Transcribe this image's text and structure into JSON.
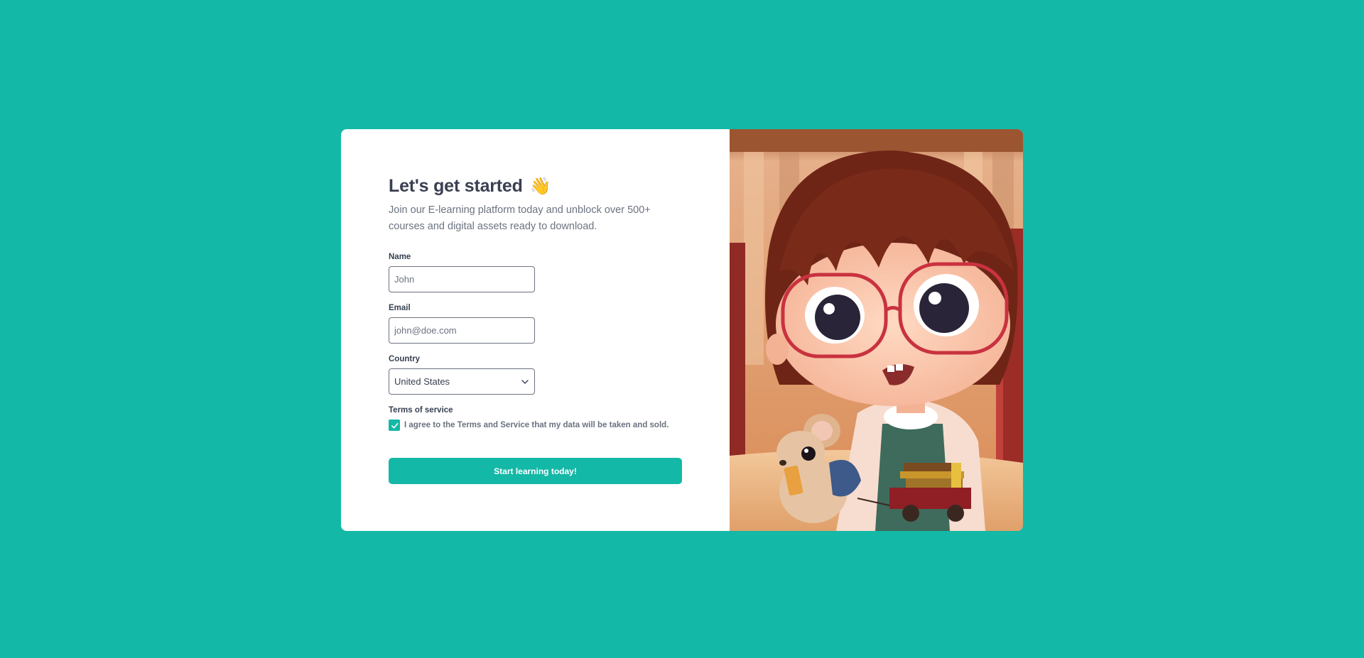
{
  "colors": {
    "background": "#14b8a6",
    "accent": "#14b8a6",
    "card": "#ffffff"
  },
  "form": {
    "title": "Let's get started",
    "title_emoji": "👋",
    "subtitle": "Join our E-learning platform today and unblock over 500+ courses and digital assets ready to download.",
    "name": {
      "label": "Name",
      "placeholder": "John"
    },
    "email": {
      "label": "Email",
      "placeholder": "john@doe.com"
    },
    "country": {
      "label": "Country",
      "selected": "United States",
      "icon": "chevron-down-icon"
    },
    "terms": {
      "label": "Terms of service",
      "checked": true,
      "text": "I agree to the Terms and Service that my data will be taken and sold."
    },
    "submit_label": "Start learning today!"
  },
  "illustration": {
    "subject": "girl-with-glasses-and-mouse-illustration"
  }
}
